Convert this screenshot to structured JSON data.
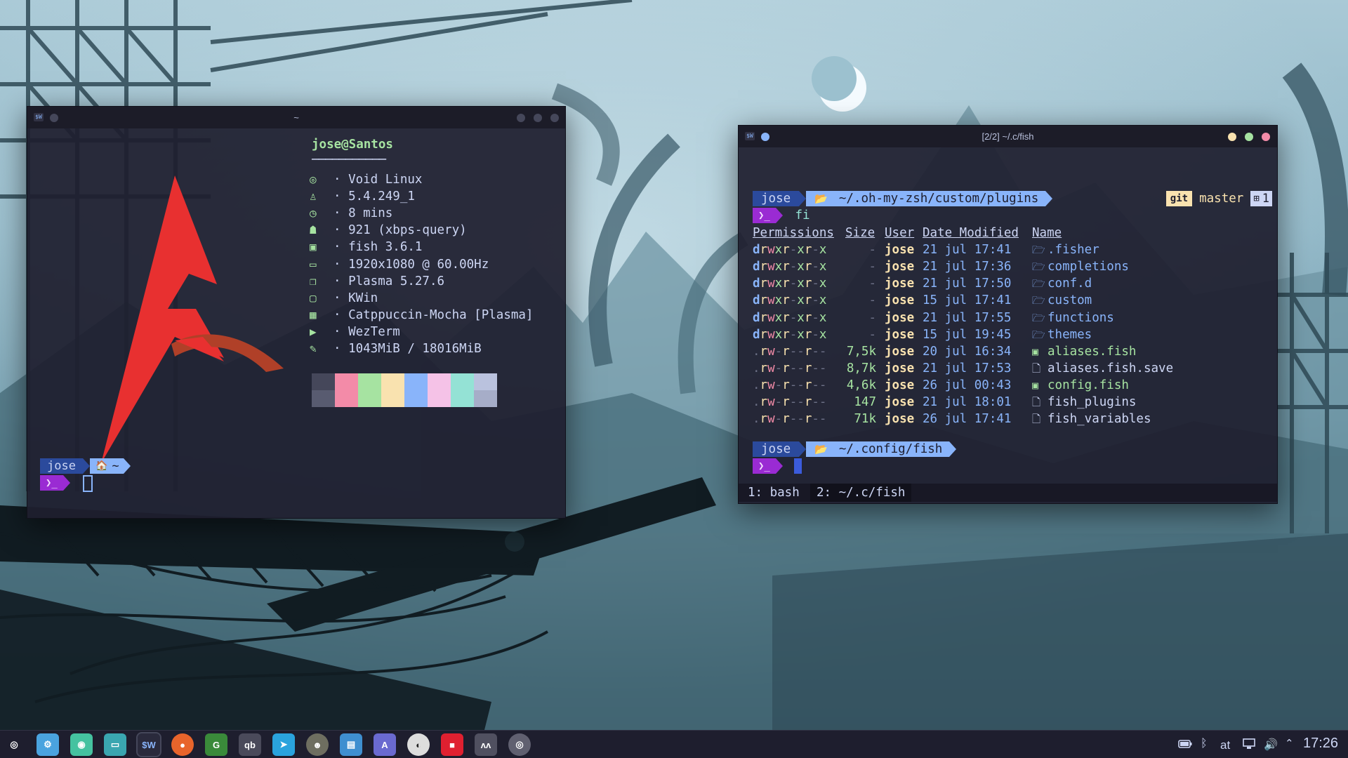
{
  "left_terminal": {
    "title": "~",
    "badge": "$W",
    "user_host": "jose@Santos",
    "separator": "───────────",
    "info": [
      {
        "icon": "void-icon",
        "text": "· Void Linux"
      },
      {
        "icon": "penguin-icon",
        "text": "· 5.4.249_1"
      },
      {
        "icon": "clock-icon",
        "text": "· 8 mins"
      },
      {
        "icon": "ghost-icon",
        "text": "· 921 (xbps-query)"
      },
      {
        "icon": "terminal-icon",
        "text": "· fish 3.6.1"
      },
      {
        "icon": "monitor-icon",
        "text": "· 1920x1080 @ 60.00Hz"
      },
      {
        "icon": "window-icon",
        "text": "· Plasma 5.27.6"
      },
      {
        "icon": "window-frame-icon",
        "text": "· KWin"
      },
      {
        "icon": "grid-icon",
        "text": "· Catppuccin-Mocha [Plasma]"
      },
      {
        "icon": "prompt-icon",
        "text": "· WezTerm"
      },
      {
        "icon": "ram-icon",
        "text": "· 1043MiB / 18016MiB"
      }
    ],
    "palette_top": [
      "#45475a",
      "#f38ba8",
      "#a6e3a1",
      "#f9e2af",
      "#89b4fa",
      "#f5c2e7",
      "#94e2d5",
      "#bac2de"
    ],
    "palette_bottom": [
      "#585b70",
      "#f38ba8",
      "#a6e3a1",
      "#f9e2af",
      "#89b4fa",
      "#f5c2e7",
      "#94e2d5",
      "#a6adc8"
    ],
    "prompt_user": "jose",
    "prompt_dir": "~",
    "prompt_symbol": "❯_"
  },
  "right_terminal": {
    "title": "[2/2] ~/.c/fish",
    "badge": "$W",
    "prompt1": {
      "user": "jose",
      "dir": "~/.oh-my-zsh/custom/plugins",
      "git_label": "git",
      "branch": "master",
      "status": "1"
    },
    "command_line": "fi",
    "prompt_symbol": "❯_",
    "headers": {
      "permissions": "Permissions",
      "size": "Size",
      "user": "User",
      "date": "Date Modified",
      "name": "Name"
    },
    "rows": [
      {
        "perm": "drwxr-xr-x",
        "size": "-",
        "user": "jose",
        "date": "21 jul 17:41",
        "name": ".fisher",
        "kind": "dir"
      },
      {
        "perm": "drwxr-xr-x",
        "size": "-",
        "user": "jose",
        "date": "21 jul 17:36",
        "name": "completions",
        "kind": "dir"
      },
      {
        "perm": "drwxr-xr-x",
        "size": "-",
        "user": "jose",
        "date": "21 jul 17:50",
        "name": "conf.d",
        "kind": "dir"
      },
      {
        "perm": "drwxr-xr-x",
        "size": "-",
        "user": "jose",
        "date": "15 jul 17:41",
        "name": "custom",
        "kind": "dir"
      },
      {
        "perm": "drwxr-xr-x",
        "size": "-",
        "user": "jose",
        "date": "21 jul 17:55",
        "name": "functions",
        "kind": "dir"
      },
      {
        "perm": "drwxr-xr-x",
        "size": "-",
        "user": "jose",
        "date": "15 jul 19:45",
        "name": "themes",
        "kind": "dir"
      },
      {
        "perm": ".rw-r--r--",
        "size": "7,5k",
        "user": "jose",
        "date": "20 jul 16:34",
        "name": "aliases.fish",
        "kind": "fish"
      },
      {
        "perm": ".rw-r--r--",
        "size": "8,7k",
        "user": "jose",
        "date": "21 jul 17:53",
        "name": "aliases.fish.save",
        "kind": "file"
      },
      {
        "perm": ".rw-r--r--",
        "size": "4,6k",
        "user": "jose",
        "date": "26 jul 00:43",
        "name": "config.fish",
        "kind": "fish"
      },
      {
        "perm": ".rw-r--r--",
        "size": "147",
        "user": "jose",
        "date": "21 jul 18:01",
        "name": "fish_plugins",
        "kind": "file"
      },
      {
        "perm": ".rw-r--r--",
        "size": "71k",
        "user": "jose",
        "date": "26 jul 17:41",
        "name": "fish_variables",
        "kind": "file"
      }
    ],
    "prompt2": {
      "user": "jose",
      "dir": "~/.config/fish"
    },
    "tabs": [
      {
        "label": "1: bash",
        "active": false
      },
      {
        "label": "2: ~/.c/fish",
        "active": true
      }
    ]
  },
  "taskbar": {
    "apps": [
      {
        "name": "app-launcher",
        "label": "◎",
        "color": "#1e1e2e"
      },
      {
        "name": "system-settings",
        "label": "⚙",
        "color": "#4aa3df"
      },
      {
        "name": "discover",
        "label": "◉",
        "color": "#45c2a0"
      },
      {
        "name": "files",
        "label": "▭",
        "color": "#3aa6b0"
      },
      {
        "name": "wezterm",
        "label": "$W",
        "color": "#2a2a3c"
      },
      {
        "name": "firefox",
        "label": "●",
        "color": "#e8642b"
      },
      {
        "name": "gpu-viewer",
        "label": "G",
        "color": "#3a8a3a"
      },
      {
        "name": "qbittorrent",
        "label": "qb",
        "color": "#4a4a5a"
      },
      {
        "name": "telegram",
        "label": "➤",
        "color": "#2aa3dd"
      },
      {
        "name": "gimp",
        "label": "☻",
        "color": "#6e6e60"
      },
      {
        "name": "messages",
        "label": "▤",
        "color": "#3f8fd0"
      },
      {
        "name": "arch-app",
        "label": "A",
        "color": "#6a6ad0"
      },
      {
        "name": "media-app",
        "label": "◐",
        "color": "#dddddd"
      },
      {
        "name": "recorder",
        "label": "■",
        "color": "#e02030"
      },
      {
        "name": "audio-app",
        "label": "ʌʌ",
        "color": "#505060"
      },
      {
        "name": "utility-app",
        "label": "◎",
        "color": "#606070"
      }
    ],
    "tray": {
      "keyboard": "at",
      "time": "17:26"
    }
  }
}
